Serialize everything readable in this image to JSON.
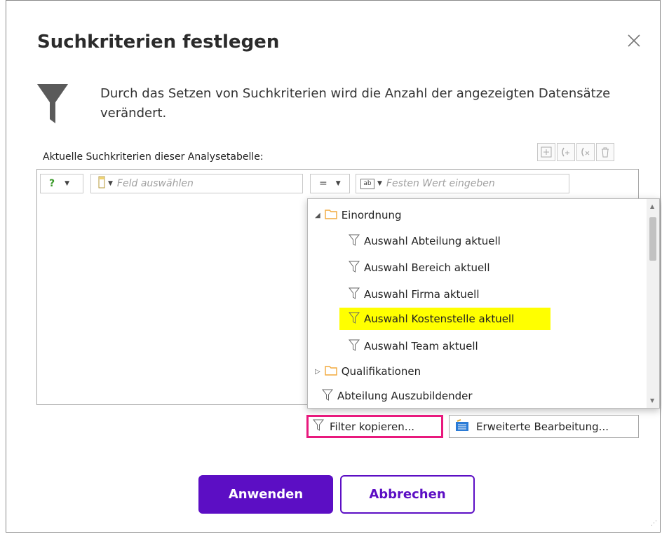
{
  "dialog": {
    "title": "Suchkriterien festlegen",
    "description": "Durch das Setzen von Suchkriterien wird die Anzahl der angezeigten Datensätze verändert.",
    "criteria_label": "Aktuelle Suchkriterien dieser Analysetabelle:"
  },
  "criteria_row": {
    "operator_symbol": "?",
    "field_placeholder": "Feld auswählen",
    "comparator": "=",
    "value_type_icon": "ab",
    "value_placeholder": "Festen Wert eingeben"
  },
  "dropdown": {
    "items": [
      {
        "label": "Einordnung",
        "type": "folder",
        "expanded": true
      },
      {
        "label": "Auswahl Abteilung aktuell",
        "type": "filter"
      },
      {
        "label": "Auswahl Bereich aktuell",
        "type": "filter"
      },
      {
        "label": "Auswahl Firma aktuell",
        "type": "filter"
      },
      {
        "label": "Auswahl Kostenstelle aktuell",
        "type": "filter",
        "highlighted": true
      },
      {
        "label": "Auswahl Team aktuell",
        "type": "filter"
      },
      {
        "label": "Qualifikationen",
        "type": "folder",
        "expanded": false
      },
      {
        "label": "Abteilung Auszubildender",
        "type": "filter"
      }
    ]
  },
  "buttons": {
    "filter_copy": "Filter kopieren...",
    "extended_edit": "Erweiterte Bearbeitung...",
    "apply": "Anwenden",
    "cancel": "Abbrechen"
  },
  "colors": {
    "accent": "#5c0ec4",
    "highlight": "#ffff00",
    "callout": "#e8197d",
    "folder": "#f2a93b"
  }
}
